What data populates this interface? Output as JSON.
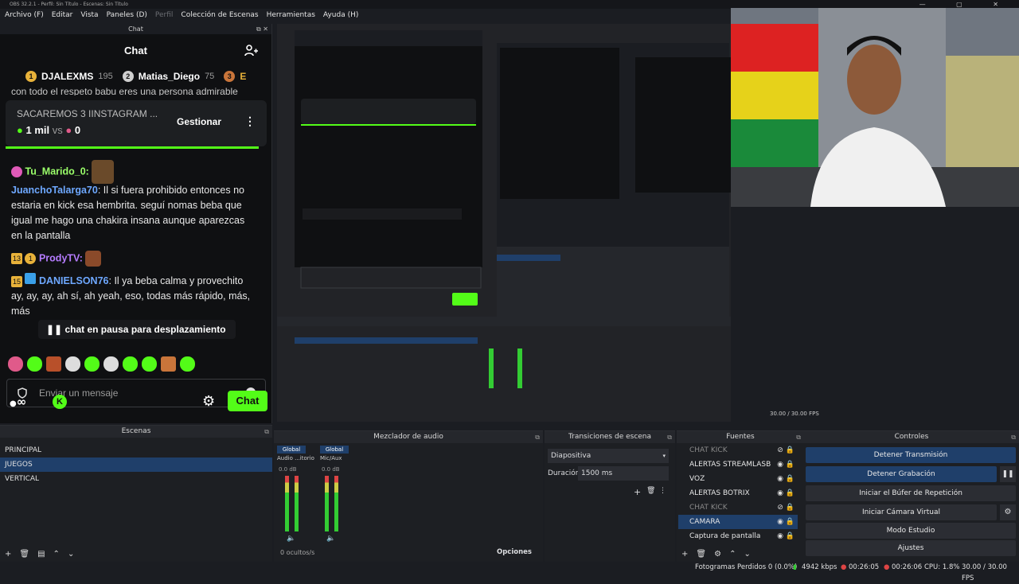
{
  "window": {
    "title": "OBS 32.2.1 - Perfil: Sin Título - Escenas: Sin Título",
    "controls": "—  ▢  ✕"
  },
  "menu": [
    "Archivo (F)",
    "Editar",
    "Vista",
    "Paneles (D)",
    "Perfil",
    "Colección de Escenas",
    "Herramientas",
    "Ayuda (H)"
  ],
  "chat": {
    "dock_title": "Chat",
    "header": "Chat",
    "leaders": [
      {
        "rank": "1",
        "name": "DJALEXMS",
        "count": "195"
      },
      {
        "rank": "2",
        "name": "Matias_Diego",
        "count": "75"
      },
      {
        "rank": "3",
        "name": "E",
        "count": ""
      }
    ],
    "hidden_line": "con todo el respeto babu eres una persona admirable",
    "pinned": {
      "title": "SACAREMOS 3 IINSTAGRAM ...",
      "vote_left": "1 mil",
      "vs": "vs",
      "vote_right": "0",
      "manage": "Gestionar"
    },
    "messages": [
      {
        "user": "Tu_Marido_0",
        "text": ""
      },
      {
        "user": "JuanchoTalarga70",
        "text": ": Il si fuera prohibido entonces no estaria en kick esa hembrita. seguí nomas beba que igual me hago una chakira insana aunque aparezcas en la pantalla"
      },
      {
        "user": "ProdyTV",
        "text": "",
        "badge": "13"
      },
      {
        "user": "DANIELSON76",
        "text": ": Il ya beba calma y provechito ay, ay, ay, ah sí, ah yeah, eso, todas más rápido, más, más",
        "badge": "15"
      }
    ],
    "pause": "chat en pausa para desplazamiento",
    "input_placeholder": "Enviar un mensaje",
    "send": "Chat",
    "infinity": "∞"
  },
  "docks": {
    "scenes": {
      "title": "Escenas",
      "items": [
        "PRINCIPAL",
        "JUEGOS",
        "VERTICAL"
      ],
      "selected": 1
    },
    "mixer": {
      "title": "Mezclador de audio",
      "channels": [
        {
          "label": "Global",
          "name": "Audio ...itorio",
          "db": "0.0 dB"
        },
        {
          "label": "Global",
          "name": "Mic/Aux",
          "db": "0.0 dB"
        }
      ],
      "hidden": "0 ocultos/s",
      "options": "Opciones"
    },
    "transitions": {
      "title": "Transiciones de escena",
      "type": "Diapositiva",
      "duration_label": "Duración",
      "duration": "1500 ms"
    },
    "sources": {
      "title": "Fuentes",
      "items": [
        {
          "name": "CHAT KICK",
          "dim": true
        },
        {
          "name": "ALERTAS STREAMLASB",
          "dim": false
        },
        {
          "name": "VOZ",
          "dim": false
        },
        {
          "name": "ALERTAS BOTRIX",
          "dim": false
        },
        {
          "name": "CHAT KICK",
          "dim": true
        },
        {
          "name": "CAMARA",
          "dim": false,
          "sel": true
        },
        {
          "name": "Captura de pantalla",
          "dim": false
        }
      ]
    },
    "controls": {
      "title": "Controles",
      "buttons": [
        "Detener Transmisión",
        "Detener Grabación",
        "Iniciar el Búfer de Repetición",
        "Iniciar Cámara Virtual",
        "Modo Estudio",
        "Ajustes"
      ]
    }
  },
  "status": {
    "dropped": "Fotogramas Perdidos 0 (0.0%)",
    "kbps": "4942 kbps",
    "t1": "00:26:05",
    "t2": "00:26:06",
    "cpu": "CPU: 1.8%",
    "fps": "30.00 / 30.00 FPS"
  },
  "preview_nested": {
    "dropped": "Fotogramas Perdidos 0 (0.0%)",
    "kbps": "4942 kbps",
    "t1": "00:26:05",
    "t2": "00:26:06",
    "cpu": "CPU: 1.8%",
    "fps": "30.00 / 30.00 FPS"
  },
  "colors": {
    "kick_green": "#53fc18",
    "select_blue": "#1f3f6a",
    "user_blue": "#6ea8ff",
    "user_green": "#9bff6a"
  }
}
